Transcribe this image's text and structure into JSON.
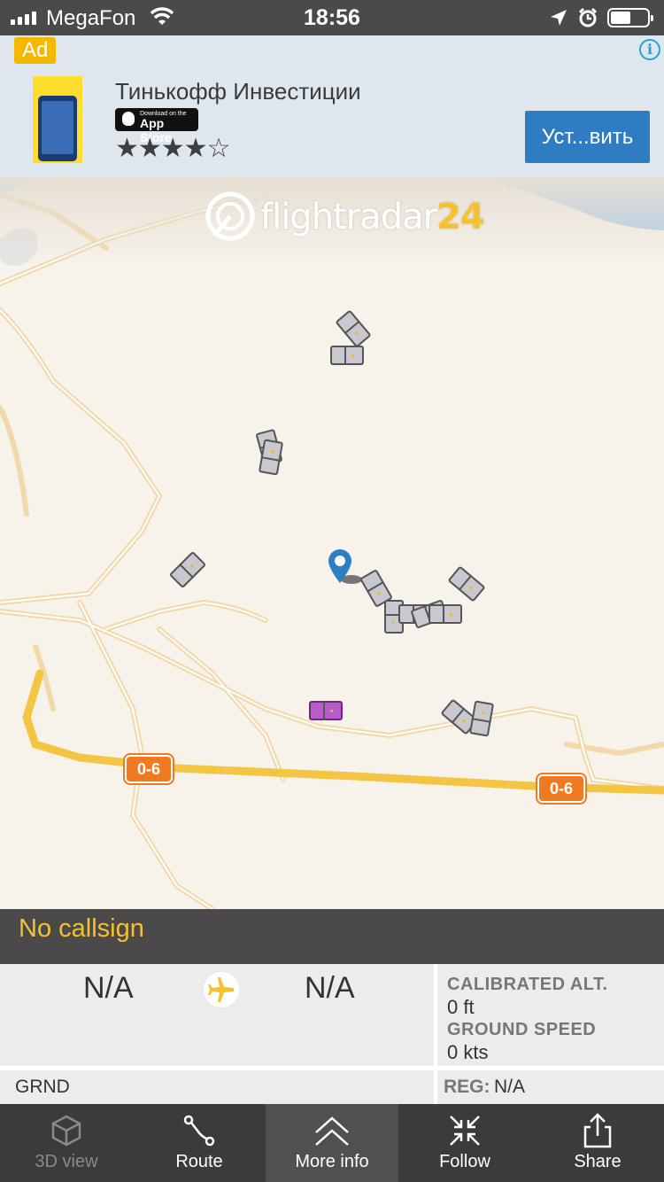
{
  "status_bar": {
    "carrier": "MegaFon",
    "time": "18:56"
  },
  "ad": {
    "tag": "Ad",
    "app_name": "Тинькофф Инвестиции",
    "store_badge_small": "Download on the",
    "store_badge_big": "App Store",
    "rating": 4.5,
    "rating_stars": "★★★★☆",
    "install_label": "Уст...вить"
  },
  "map": {
    "logo_text": "flightradar",
    "logo_number": "24",
    "road_labels": [
      "0-6",
      "0-6"
    ]
  },
  "flight": {
    "callsign": "No callsign",
    "origin": "N/A",
    "destination": "N/A",
    "calibrated_alt_label": "CALIBRATED ALT.",
    "calibrated_alt_value": "0 ft",
    "ground_speed_label": "GROUND SPEED",
    "ground_speed_value": "0 kts",
    "aircraft_type": "GRND",
    "reg_label": "REG:",
    "reg_value": "N/A"
  },
  "tabs": [
    {
      "label": "3D view",
      "icon": "cube-icon",
      "state": "disabled"
    },
    {
      "label": "Route",
      "icon": "route-icon",
      "state": "normal"
    },
    {
      "label": "More info",
      "icon": "chevron-up-icon",
      "state": "active"
    },
    {
      "label": "Follow",
      "icon": "follow-icon",
      "state": "normal"
    },
    {
      "label": "Share",
      "icon": "share-icon",
      "state": "normal"
    }
  ],
  "colors": {
    "accent_yellow": "#f5c12e",
    "ad_button": "#2f7cc3",
    "road_label": "#ee7b22",
    "selected_aircraft": "#b85cc9",
    "location_pin": "#2e7fc2"
  }
}
